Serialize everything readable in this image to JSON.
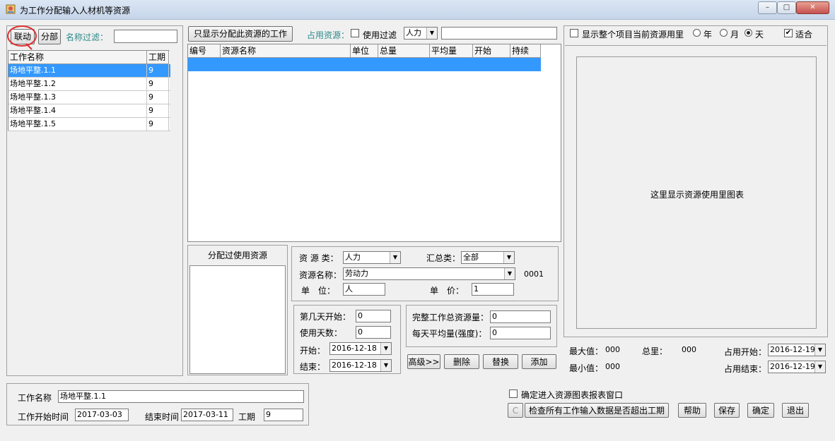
{
  "window": {
    "title": "为工作分配输入人材机等资源",
    "min_label": "–",
    "max_label": "□",
    "close_label": "✕"
  },
  "left": {
    "btn_link": "联动",
    "btn_split": "分部",
    "filter_label": "名称过滤：",
    "filter_value": "",
    "headers": [
      "工作名称",
      "工期"
    ],
    "rows": [
      {
        "name": "场地平整.1.1",
        "days": "9"
      },
      {
        "name": "场地平整.1.2",
        "days": "9"
      },
      {
        "name": "场地平整.1.3",
        "days": "9"
      },
      {
        "name": "场地平整.1.4",
        "days": "9"
      },
      {
        "name": "场地平整.1.5",
        "days": "9"
      }
    ]
  },
  "middle": {
    "btn_only_assigned": "只显示分配此资源的工作",
    "occupy_label": "占用资源：",
    "use_filter_label": "使用过滤",
    "resource_type_value": "人力",
    "filter_text": "",
    "headers": [
      "编号",
      "资源名称",
      "单位",
      "总量",
      "平均量",
      "开始",
      "持续"
    ],
    "assigned_label": "分配过使用资源",
    "form": {
      "res_type_label": "资 源 类：",
      "res_type_value": "人力",
      "summary_label": "汇总类：",
      "summary_value": "全部",
      "res_name_label": "资源名称：",
      "res_name_value": "劳动力",
      "res_code": "0001",
      "unit_label": "单　位：",
      "unit_value": "人",
      "price_label": "单　价：",
      "price_value": "1",
      "start_day_label": "第几天开始：",
      "start_day_value": "0",
      "use_days_label": "使用天数：",
      "use_days_value": "0",
      "start_label": "开始：",
      "start_value": "2016-12-18",
      "end_label": "结束：",
      "end_value": "2016-12-18",
      "total_label": "完整工作总资源量：",
      "total_value": "0",
      "daily_label": "每天平均量(强度)：",
      "daily_value": "0",
      "btn_advanced": "高级>>",
      "btn_delete": "删除",
      "btn_replace": "替换",
      "btn_add": "添加"
    }
  },
  "right": {
    "show_all_label": "显示整个项目当前资源用里",
    "year_label": "年",
    "month_label": "月",
    "day_label": "天",
    "fit_label": "适合",
    "chart_placeholder": "这里显示资源使用里图表",
    "max_label": "最大值：",
    "max_value": "000",
    "min_label": "最小值：",
    "min_value": "000",
    "total_label": "总里：",
    "total_value": "000",
    "occ_start_label": "占用开始：",
    "occ_start_value": "2016-12-19",
    "occ_end_label": "占用结束：",
    "occ_end_value": "2016-12-19"
  },
  "bottom": {
    "work_name_label": "工作名称",
    "work_name_value": "场地平整.1.1",
    "start_time_label": "工作开始时间",
    "start_time_value": "2017-03-03",
    "end_time_label": "结束时间",
    "end_time_value": "2017-03-11",
    "duration_label": "工期",
    "duration_value": "9",
    "enter_chart_label": "确定进入资源图表报表窗口",
    "btn_c": "C",
    "btn_check": "检查所有工作输入数据是否超出工期",
    "btn_help": "帮助",
    "btn_save": "保存",
    "btn_ok": "确定",
    "btn_exit": "退出"
  },
  "colors": {
    "selection": "#3399ff",
    "accent_teal": "#2e8a8a",
    "highlight_circle": "#e03030"
  }
}
